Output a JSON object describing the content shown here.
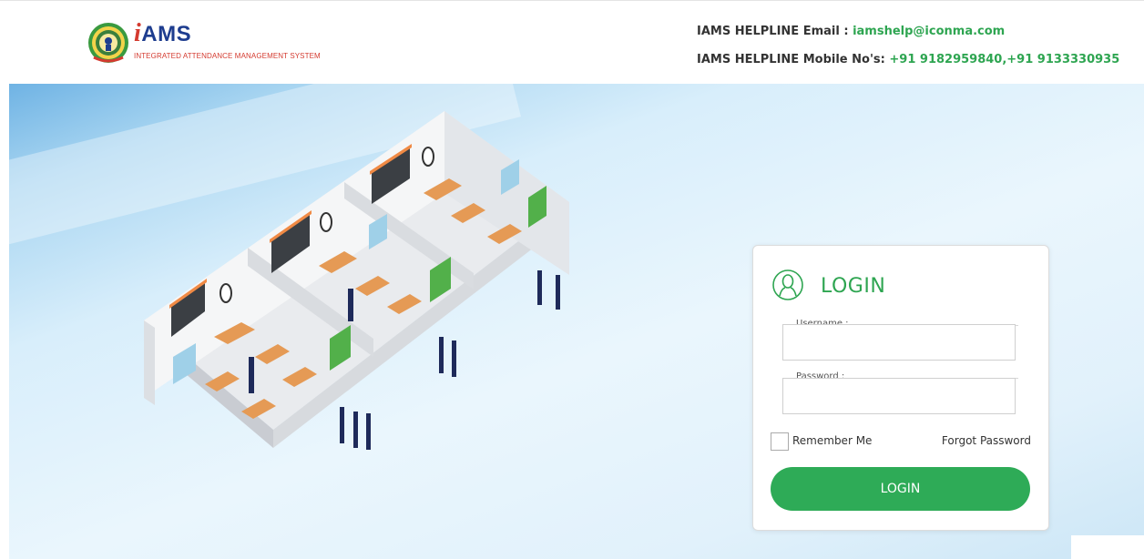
{
  "header": {
    "logo": {
      "brand": "AMS",
      "brand_prefix": "i",
      "tagline": "INTEGRATED ATTENDANCE MANAGEMENT SYSTEM",
      "emblem_icon": "andhra-pradesh-emblem-icon"
    },
    "helpline_email_label": "IAMS HELPLINE Email : ",
    "helpline_email_value": "iamshelp@iconma.com",
    "helpline_mobile_label": "IAMS HELPLINE Mobile No's: ",
    "helpline_mobile_value": "+91 9182959840,+91 9133330935"
  },
  "hero": {
    "illustration": "isometric-classrooms-illustration"
  },
  "login": {
    "icon": "user-outline-icon",
    "title": "LOGIN",
    "username_label": "Username :",
    "username_value": "",
    "password_label": "Password :",
    "password_value": "",
    "remember_label": "Remember Me",
    "remember_checked": false,
    "forgot_label": "Forgot Password",
    "button_label": "LOGIN"
  },
  "colors": {
    "accent_green": "#2eab57",
    "brand_blue": "#1e3d8f",
    "brand_red": "#d43a2f"
  }
}
